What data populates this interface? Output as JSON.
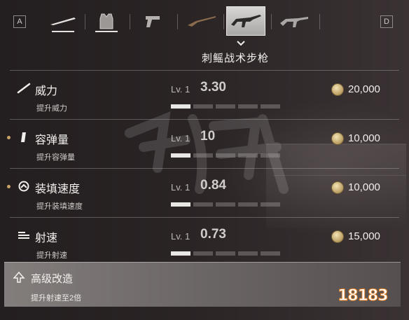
{
  "topbar": {
    "left_key": "A",
    "right_key": "D",
    "slots": [
      {
        "icon": "knife-icon",
        "selected": false
      },
      {
        "icon": "armor-vest-icon",
        "selected": false
      },
      {
        "icon": "pistol-icon",
        "selected": false
      },
      {
        "icon": "hunting-rifle-icon",
        "selected": false
      },
      {
        "icon": "tactical-rifle-icon",
        "selected": true
      },
      {
        "icon": "assault-rifle-icon",
        "selected": false
      }
    ]
  },
  "weapon_name": "刺鳐战术步枪",
  "stats": [
    {
      "icon": "power-icon",
      "name": "威力",
      "sub": "提升威力",
      "lv": "Lv. 1",
      "value": "3.30",
      "cost": "20,000",
      "bars_on": 1,
      "bars_total": 5,
      "dot": false
    },
    {
      "icon": "magazine-icon",
      "name": "容弹量",
      "sub": "提升容弹量",
      "lv": "Lv. 1",
      "value": "10",
      "cost": "10,000",
      "bars_on": 1,
      "bars_total": 5,
      "dot": true
    },
    {
      "icon": "reload-icon",
      "name": "装填速度",
      "sub": "提升装填速度",
      "lv": "Lv. 1",
      "value": "0.84",
      "cost": "10,000",
      "bars_on": 1,
      "bars_total": 5,
      "dot": true
    },
    {
      "icon": "fire-rate-icon",
      "name": "射速",
      "sub": "提升射速",
      "lv": "Lv. 1",
      "value": "0.73",
      "cost": "15,000",
      "bars_on": 1,
      "bars_total": 5,
      "dot": false
    }
  ],
  "advanced": {
    "title": "高级改造",
    "sub": "提升射速至2倍"
  },
  "watermark": "18183",
  "colors": {
    "accent_gold": "#c9a56a",
    "bar_on": "#e9e7e4"
  }
}
